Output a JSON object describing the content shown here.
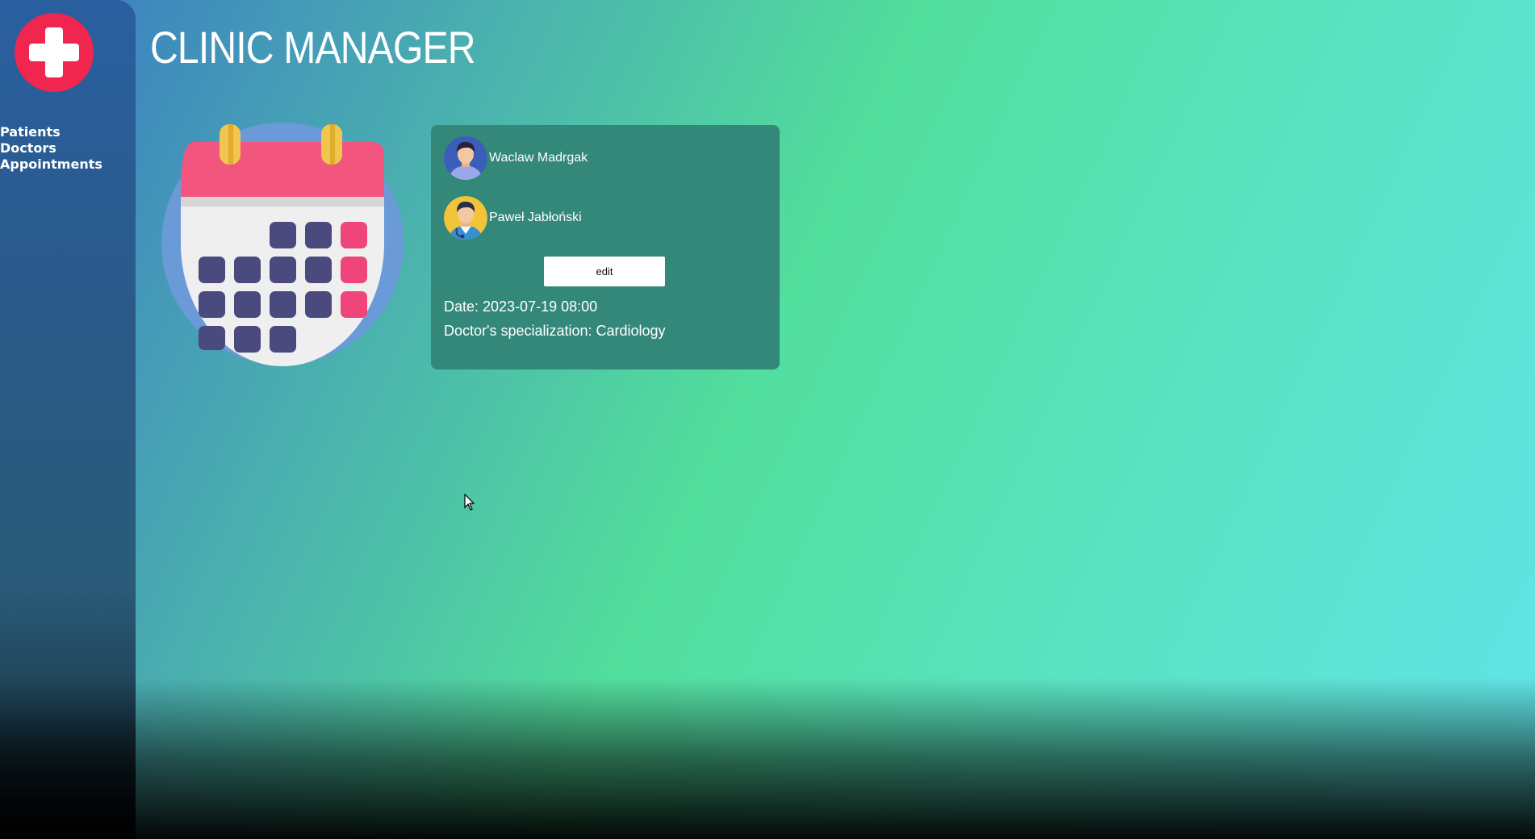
{
  "app": {
    "title": "CLINIC MANAGER"
  },
  "sidebar": {
    "logo_icon": "medical-cross-icon",
    "items": [
      {
        "label": "Patients"
      },
      {
        "label": "Doctors"
      },
      {
        "label": "Appointments"
      }
    ]
  },
  "appointment": {
    "illustration": "calendar-icon",
    "patient": {
      "name": "Waclaw Madrgak",
      "avatar_icon": "patient-avatar-icon"
    },
    "doctor": {
      "name": "Paweł Jabłoński",
      "avatar_icon": "doctor-avatar-icon"
    },
    "edit_label": "edit",
    "date_text": "Date: 2023-07-19 08:00",
    "specialization_text": "Doctor's specialization: Cardiology"
  },
  "colors": {
    "accent_red": "#f0264e",
    "card_bg": "#33887a",
    "sidebar_top": "#2a5fa0",
    "calendar_pink": "#f2557e",
    "calendar_navy": "#4a4a7e"
  }
}
